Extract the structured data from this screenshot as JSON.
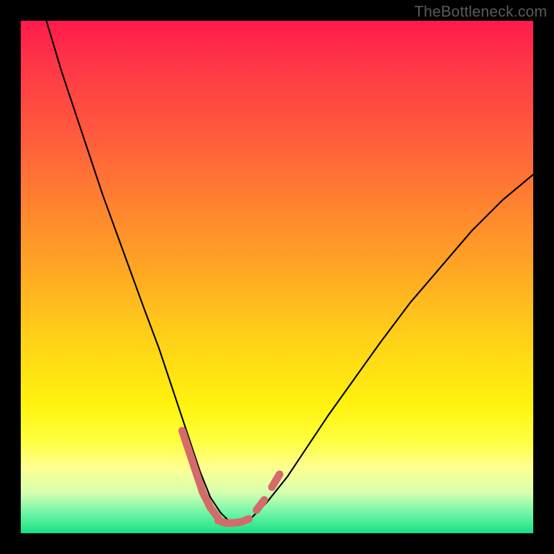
{
  "watermark": "TheBottleneck.com",
  "chart_data": {
    "type": "line",
    "title": "",
    "xlabel": "",
    "ylabel": "",
    "xlim": [
      0,
      100
    ],
    "ylim": [
      0,
      100
    ],
    "series": [
      {
        "name": "bottleneck-curve",
        "x": [
          5,
          8,
          12,
          16,
          20,
          24,
          27,
          29,
          31,
          33,
          35,
          37,
          39,
          41,
          43,
          45,
          48,
          52,
          56,
          60,
          65,
          70,
          76,
          82,
          88,
          94,
          100
        ],
        "y": [
          100,
          90,
          78,
          66,
          55,
          44,
          36,
          30,
          24,
          18,
          12,
          7,
          4,
          2,
          2,
          3,
          6,
          11,
          17,
          23,
          30,
          37,
          45,
          52,
          59,
          65,
          70
        ],
        "stroke": "#000000",
        "stroke_width": 2.2
      },
      {
        "name": "trough-marker-left",
        "x": [
          31.5,
          33.5,
          35.5,
          37.0,
          38.5
        ],
        "y": [
          20,
          14,
          8,
          5,
          3
        ],
        "stroke": "#d56a6a",
        "stroke_width": 11
      },
      {
        "name": "trough-marker-bottom",
        "x": [
          38.5,
          40.0,
          41.5,
          43.0,
          44.5
        ],
        "y": [
          2.5,
          2.0,
          2.0,
          2.2,
          2.8
        ],
        "stroke": "#d56a6a",
        "stroke_width": 11
      },
      {
        "name": "trough-marker-right-a",
        "x": [
          46.0,
          47.5
        ],
        "y": [
          4.5,
          6.5
        ],
        "stroke": "#d56a6a",
        "stroke_width": 11
      },
      {
        "name": "trough-marker-right-b",
        "x": [
          49.0,
          50.5
        ],
        "y": [
          9.0,
          11.5
        ],
        "stroke": "#d56a6a",
        "stroke_width": 11
      }
    ]
  }
}
